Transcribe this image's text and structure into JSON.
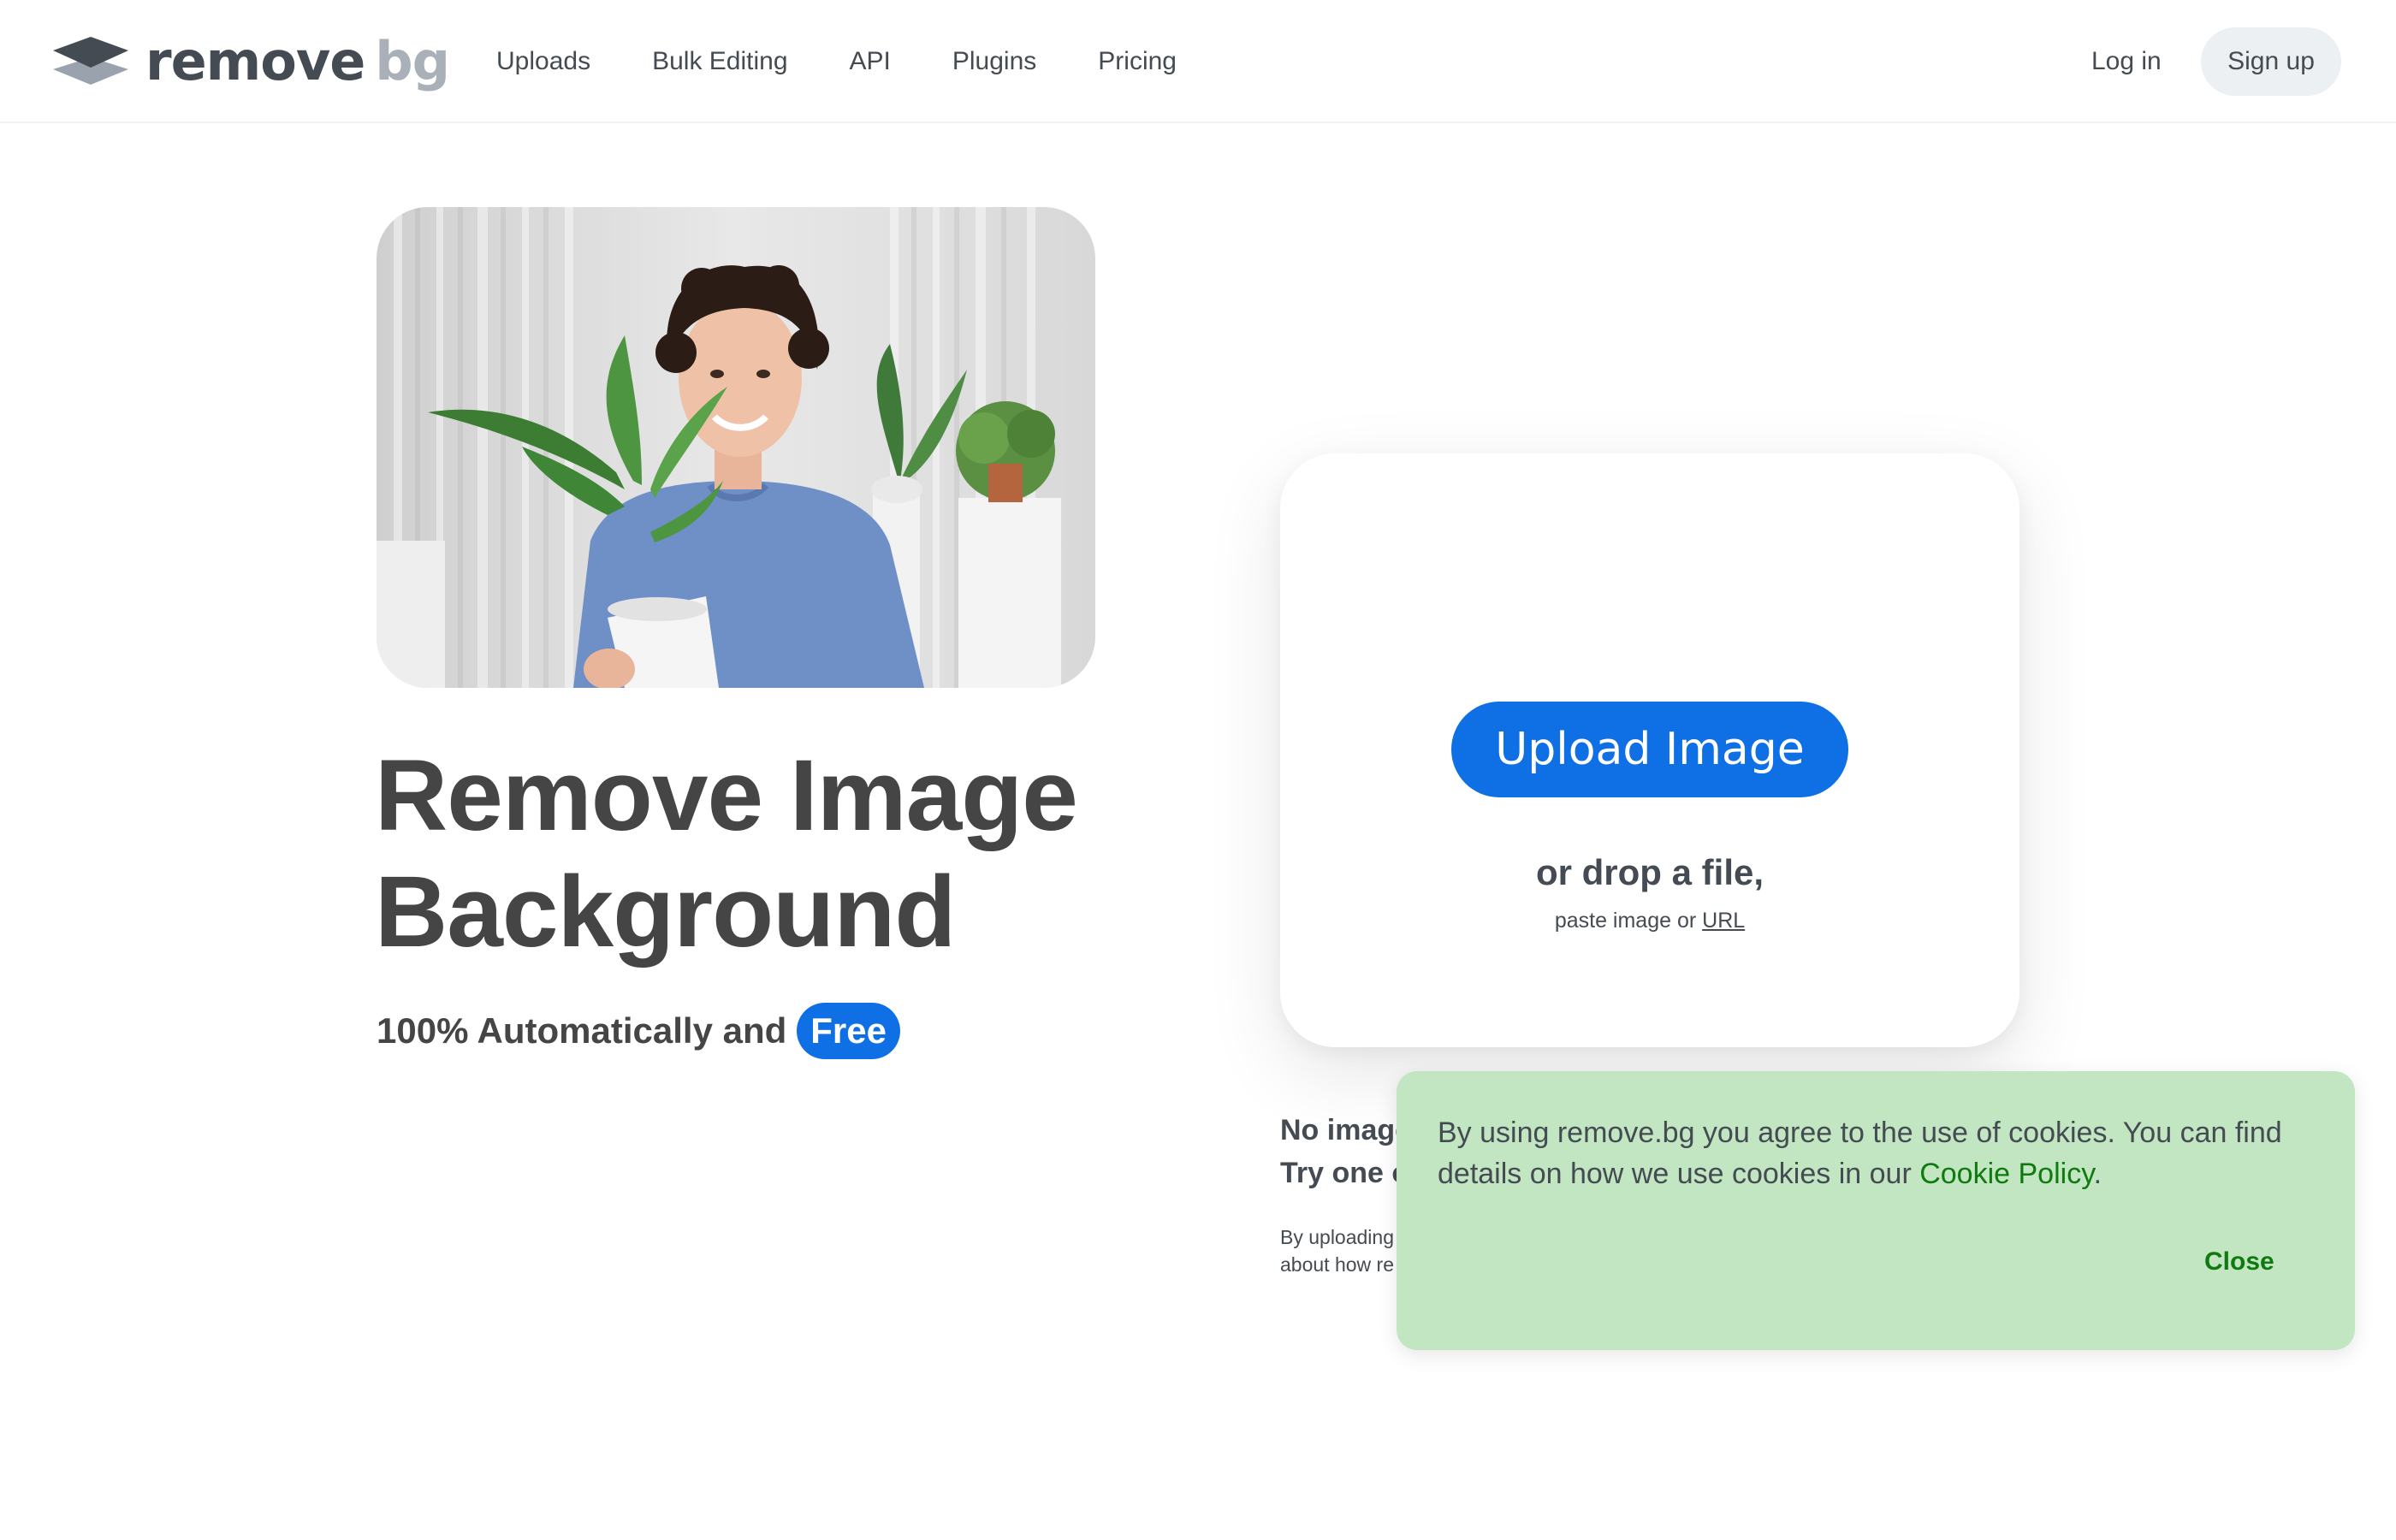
{
  "header": {
    "logo": {
      "word1": "remove",
      "word2": "bg"
    },
    "nav": [
      "Uploads",
      "Bulk Editing",
      "API",
      "Plugins",
      "Pricing"
    ],
    "login": "Log in",
    "signup": "Sign up"
  },
  "hero": {
    "image_alt": "man-holding-plant-photo",
    "headline_line1": "Remove Image",
    "headline_line2": "Background",
    "subline_text": "100% Automatically and",
    "subline_badge": "Free"
  },
  "upload": {
    "button": "Upload Image",
    "drop_title": "or drop a file,",
    "drop_sub_prefix": "paste image or ",
    "drop_sub_link": "URL"
  },
  "examples": {
    "line1": "No image",
    "line2": "Try one o"
  },
  "legal": {
    "line1": "By uploading",
    "line2": "about how re"
  },
  "cookie_banner": {
    "text": "By using remove.bg you agree to the use of cookies. You can find details on how we use cookies in our ",
    "link": "Cookie Policy",
    "text_end": ".",
    "close": "Close"
  },
  "colors": {
    "accent": "#0f70e6",
    "cookie_bg": "#c1e6c1",
    "cookie_link": "#107a10",
    "text": "#454b52"
  }
}
